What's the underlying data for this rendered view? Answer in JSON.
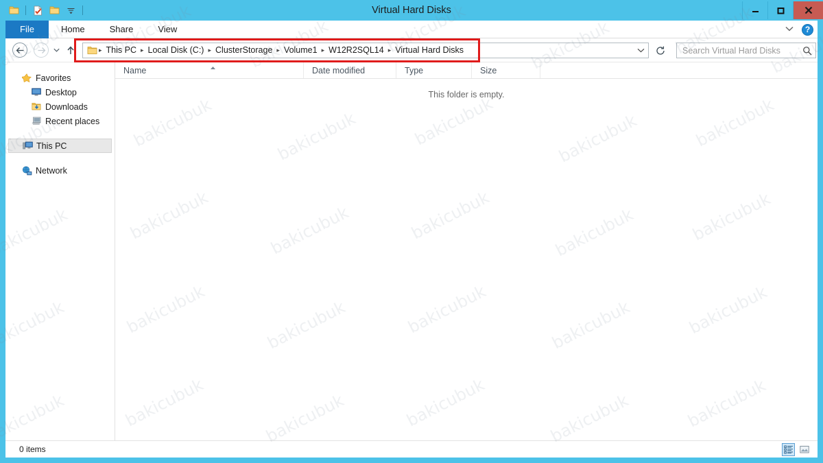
{
  "window": {
    "title": "Virtual Hard Disks",
    "accent_color": "#4cc2e8",
    "close_color": "#c75b53",
    "controls": {
      "minimize": "—",
      "maximize": "❐",
      "close": "✕"
    }
  },
  "quick_access": {
    "items": [
      {
        "name": "folder-icon",
        "glyph": "folder"
      },
      {
        "name": "properties-icon",
        "glyph": "doc-check"
      },
      {
        "name": "new-folder-icon",
        "glyph": "folder"
      },
      {
        "name": "customize-qat-icon",
        "glyph": "chevron-down"
      }
    ]
  },
  "ribbon": {
    "tabs": [
      {
        "label": "File",
        "active": true
      },
      {
        "label": "Home",
        "active": false
      },
      {
        "label": "Share",
        "active": false
      },
      {
        "label": "View",
        "active": false
      }
    ],
    "expand_icon": "chevron-down-icon",
    "help_icon": "help-icon",
    "help_glyph": "?"
  },
  "navigation": {
    "back_glyph": "←",
    "forward_glyph": "→",
    "recent_glyph": "▾",
    "up_glyph": "↑",
    "refresh_glyph": "↻",
    "dropdown_glyph": "⌄"
  },
  "address_bar": {
    "breadcrumbs": [
      "This PC",
      "Local Disk (C:)",
      "ClusterStorage",
      "Volume1",
      "W12R2SQL14",
      "Virtual Hard Disks"
    ],
    "separator": "▸",
    "highlight_color": "#e01b1b"
  },
  "search": {
    "placeholder": "Search Virtual Hard Disks",
    "icon": "search-icon",
    "icon_glyph": "⌕"
  },
  "sidebar": {
    "groups": [
      {
        "label": "Favorites",
        "icon": "star-icon",
        "children": [
          {
            "label": "Desktop",
            "icon": "desktop-icon"
          },
          {
            "label": "Downloads",
            "icon": "downloads-icon"
          },
          {
            "label": "Recent places",
            "icon": "recent-places-icon"
          }
        ]
      },
      {
        "label": "This PC",
        "icon": "this-pc-icon",
        "selected": true,
        "children": []
      },
      {
        "label": "Network",
        "icon": "network-icon",
        "children": []
      }
    ]
  },
  "file_list": {
    "columns": [
      {
        "label": "Name",
        "sorted": true,
        "sort_glyph": "▲"
      },
      {
        "label": "Date modified",
        "sorted": false
      },
      {
        "label": "Type",
        "sorted": false
      },
      {
        "label": "Size",
        "sorted": false
      }
    ],
    "rows": [],
    "empty_message": "This folder is empty."
  },
  "status_bar": {
    "item_count": "0 items",
    "views": [
      {
        "name": "details-view-button",
        "active": true
      },
      {
        "name": "large-icons-view-button",
        "active": false
      }
    ]
  },
  "watermark": {
    "text": "bakicubuk"
  }
}
